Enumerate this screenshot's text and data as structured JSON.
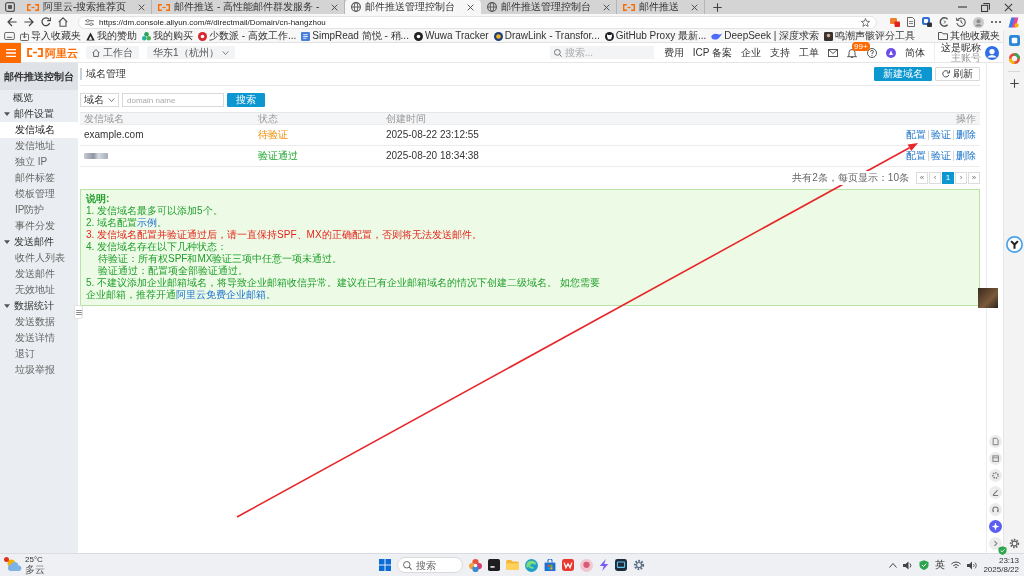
{
  "browser": {
    "tabs": [
      {
        "title": "阿里云-搜索推荐页",
        "selected": false
      },
      {
        "title": "邮件推送 - 高性能邮件群发服务 -",
        "selected": false
      },
      {
        "title": "邮件推送管理控制台",
        "selected": true
      },
      {
        "title": "邮件推送管理控制台",
        "selected": false
      },
      {
        "title": "邮件推送",
        "selected": false
      }
    ],
    "address": "https://dm.console.aliyun.com/#/directmail/Domain/cn-hangzhou",
    "bookmarks": [
      "导入收藏夹",
      "我的赞助",
      "我的购买",
      "少数派 - 高效工作...",
      "SimpRead 简悦 - 稍...",
      "Wuwa Tracker",
      "DrawLink - Transfor...",
      "GitHub Proxy 最新...",
      "DeepSeek | 深度求索",
      "鸣潮声骸评分工具"
    ],
    "other_bookmarks": "其他收藏夹"
  },
  "header": {
    "logo": "阿里云",
    "workbench": "工作台",
    "region": "华东1（杭州）",
    "search_placeholder": "搜索...",
    "nav": [
      "费用",
      "ICP 备案",
      "企业",
      "支持",
      "工单"
    ],
    "badge": "99+",
    "language": "简体",
    "user": "这是昵称",
    "account": "主账号"
  },
  "sidebar": {
    "title": "邮件推送控制台",
    "items": [
      {
        "kind": "link",
        "label": "概览",
        "selected": false
      },
      {
        "kind": "group",
        "label": "邮件设置",
        "expanded": true,
        "children": [
          {
            "label": "发信域名",
            "selected": true
          },
          {
            "label": "发信地址",
            "selected": false
          },
          {
            "label": "独立 IP",
            "selected": false
          },
          {
            "label": "邮件标签",
            "selected": false
          },
          {
            "label": "模板管理",
            "selected": false
          },
          {
            "label": "IP防护",
            "selected": false
          },
          {
            "label": "事件分发",
            "selected": false
          }
        ]
      },
      {
        "kind": "group",
        "label": "发送邮件",
        "expanded": true,
        "children": [
          {
            "label": "收件人列表",
            "selected": false
          },
          {
            "label": "发送邮件",
            "selected": false
          },
          {
            "label": "无效地址",
            "selected": false
          }
        ]
      },
      {
        "kind": "group",
        "label": "数据统计",
        "expanded": true,
        "children": [
          {
            "label": "发送数据",
            "selected": false
          },
          {
            "label": "发送详情",
            "selected": false
          },
          {
            "label": "退订",
            "selected": false
          },
          {
            "label": "垃圾举报",
            "selected": false
          }
        ]
      }
    ]
  },
  "page": {
    "title": "域名管理",
    "buttons": [
      {
        "label": "新建域名",
        "kind": "primary"
      },
      {
        "label": "刷新",
        "kind": "refresh"
      }
    ]
  },
  "filter": {
    "field": "域名",
    "placeholder": "domain name",
    "button": "搜索"
  },
  "table": {
    "columns": [
      "发信域名",
      "状态",
      "创建时间",
      "操作"
    ],
    "rows": [
      {
        "domain": "example.com",
        "domain_hidden": false,
        "status": "待验证",
        "verified": false,
        "created": "2025-08-22 23:12:55",
        "actions": [
          "配置",
          "验证",
          "删除"
        ]
      },
      {
        "domain_hidden": true,
        "status": "验证通过",
        "verified": true,
        "created": "2025-08-20 18:34:38",
        "actions": [
          "配置",
          "验证",
          "删除"
        ]
      }
    ]
  },
  "pagination": {
    "summary": "共有2条，每页显示：10条",
    "buttons": [
      {
        "label": "«",
        "selected": false
      },
      {
        "label": "‹",
        "selected": false
      },
      {
        "label": "1",
        "selected": true
      },
      {
        "label": "›",
        "selected": false
      },
      {
        "label": "»",
        "selected": false
      }
    ]
  },
  "notice": {
    "title": "说明:",
    "lines": [
      {
        "kind": "info",
        "text": "1. 发信域名最多可以添加5个。"
      },
      {
        "kind": "info",
        "parts": [
          {
            "kind": "plain",
            "text": "2. 域名配置"
          },
          {
            "kind": "link",
            "text": "示例"
          },
          {
            "kind": "plain",
            "text": "。"
          }
        ]
      },
      {
        "kind": "warning",
        "text": "3. 发信域名配置并验证通过后，请一直保持SPF、MX的正确配置，否则将无法发送邮件。"
      },
      {
        "kind": "info",
        "text": "4. 发信域名存在以下几种状态：",
        "children": [
          {
            "text": "待验证：所有权SPF和MX验证三项中任意一项未通过。"
          },
          {
            "text": "验证通过：配置项全部验证通过。"
          }
        ]
      },
      {
        "kind": "info",
        "parts": [
          {
            "kind": "plain",
            "text": "5. 不建议添加企业邮箱域名，将导致企业邮箱收信异常。建议在已有企业邮箱域名的情况下创建二级域名。 如您需要企业邮箱，推荐开通"
          },
          {
            "kind": "link",
            "text": "阿里云免费企业邮箱"
          },
          {
            "kind": "plain",
            "text": "。"
          }
        ]
      }
    ]
  },
  "taskbar": {
    "temperature": "25°C",
    "weather": "多云",
    "search_placeholder": "搜索",
    "input_method": "英",
    "time": "23:13",
    "date": "2025/8/22"
  }
}
